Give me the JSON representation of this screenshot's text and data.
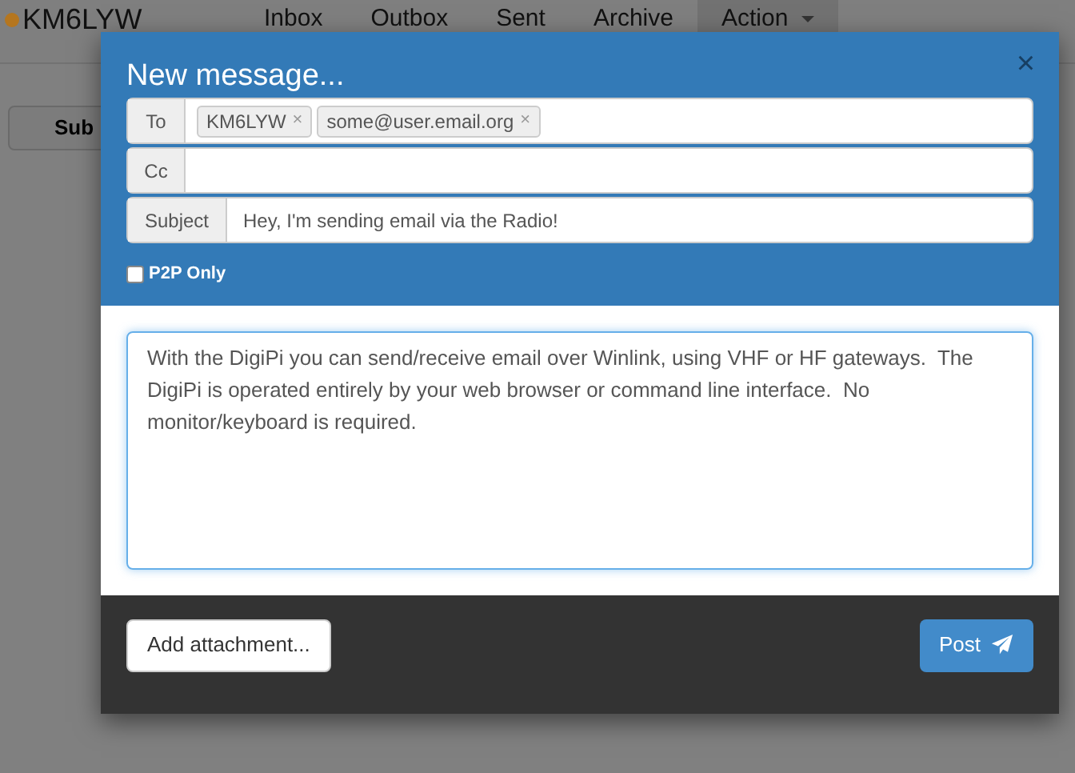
{
  "navbar": {
    "brand": "KM6LYW",
    "items": [
      {
        "label": "Inbox",
        "selected": false
      },
      {
        "label": "Outbox",
        "selected": false
      },
      {
        "label": "Sent",
        "selected": false
      },
      {
        "label": "Archive",
        "selected": false
      },
      {
        "label": "Action",
        "selected": true,
        "dropdown": true
      }
    ]
  },
  "background_button": "Sub",
  "modal": {
    "title": "New message...",
    "close": "×",
    "to": {
      "label": "To",
      "tags": [
        {
          "text": "KM6LYW",
          "remove": "×"
        },
        {
          "text": "some@user.email.org",
          "remove": "×"
        }
      ]
    },
    "cc": {
      "label": "Cc"
    },
    "subject": {
      "label": "Subject",
      "value": "Hey, I'm sending email via the Radio!"
    },
    "p2p_only": {
      "label": "P2P Only",
      "checked": false
    },
    "body": "With the DigiPi you can send/receive email over Winlink, using VHF or HF gateways.  The DigiPi is operated entirely by your web browser or command line interface.  No monitor/keyboard is required.",
    "attach_button": "Add attachment...",
    "post_button": "Post"
  }
}
